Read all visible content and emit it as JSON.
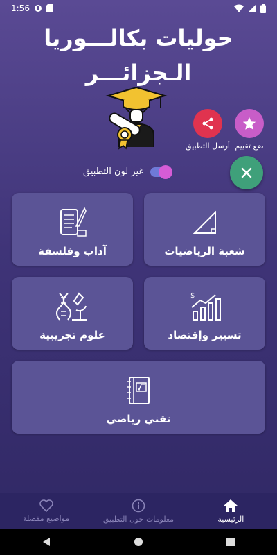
{
  "status": {
    "time": "1:56"
  },
  "header": {
    "title_line1": "حوليات بكالـــوريا",
    "title_line2": "الـجزائـــر"
  },
  "actions": {
    "rate_label": "ضع تقييم",
    "share_label": "أرسل التطبيق",
    "toggle_label": "غير لون التطبيق"
  },
  "cards": [
    {
      "label": "شعبة الرياضيات",
      "icon": "triangle-icon"
    },
    {
      "label": "آداب وفلسفة",
      "icon": "scroll-quill-icon"
    },
    {
      "label": "تسيير وإقتصاد",
      "icon": "growth-chart-icon"
    },
    {
      "label": "علوم تجريبية",
      "icon": "dna-microscope-icon"
    },
    {
      "label": "تقني رياضي",
      "icon": "notebook-sqrt-icon"
    }
  ],
  "bottom_nav": [
    {
      "label": "الرئيسية",
      "icon": "home-icon",
      "active": true
    },
    {
      "label": "معلومات حول التطبيق",
      "icon": "info-icon",
      "active": false
    },
    {
      "label": "مواضيع مفضلة",
      "icon": "heart-icon",
      "active": false
    }
  ],
  "colors": {
    "background": "#3f3478",
    "card": "#5b5496",
    "fab": "#3fa07a",
    "share": "#e0334f",
    "rate": "#c85dc8"
  }
}
